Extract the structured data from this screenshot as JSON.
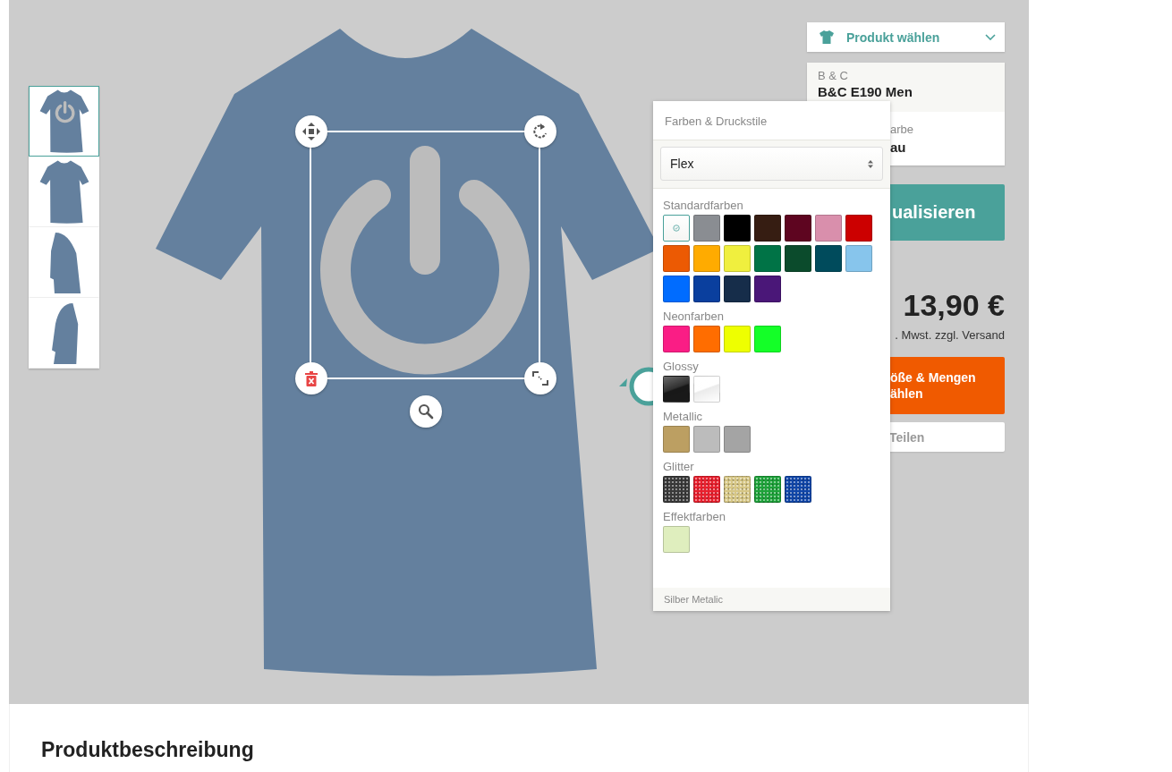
{
  "thumbnails": [
    {
      "kind": "front-design",
      "selected": true
    },
    {
      "kind": "back",
      "selected": false
    },
    {
      "kind": "sleeve-left",
      "selected": false
    },
    {
      "kind": "sleeve-right",
      "selected": false
    }
  ],
  "product_selector": {
    "label": "Produkt wählen"
  },
  "product_info": {
    "brand": "B & C",
    "name": "B&C E190 Men",
    "color_label": "arbe",
    "color_value": "au"
  },
  "update_button": "ualisieren",
  "price": "13,90 €",
  "price_note": ". Mwst. zzgl. Versand",
  "order_button": [
    "öße & Mengen",
    "ählen"
  ],
  "share_button": "Teilen",
  "color_panel": {
    "title": "Farben & Druckstile",
    "print_style": "Flex",
    "groups": [
      {
        "name": "Standardfarben",
        "swatches": [
          {
            "kind": "solid",
            "color": "#ffffff",
            "selected": true
          },
          {
            "kind": "solid",
            "color": "#8a8d92",
            "selected": false
          },
          {
            "kind": "solid",
            "color": "#000000",
            "selected": false
          },
          {
            "kind": "solid",
            "color": "#361d12",
            "selected": false
          },
          {
            "kind": "solid",
            "color": "#5e0520",
            "selected": false
          },
          {
            "kind": "solid",
            "color": "#d98fac",
            "selected": false
          },
          {
            "kind": "solid",
            "color": "#cc0000",
            "selected": false
          },
          {
            "kind": "solid",
            "color": "#ec5a03",
            "selected": false
          },
          {
            "kind": "solid",
            "color": "#ffab00",
            "selected": false
          },
          {
            "kind": "solid",
            "color": "#f0ef3e",
            "selected": false
          },
          {
            "kind": "solid",
            "color": "#007346",
            "selected": false
          },
          {
            "kind": "solid",
            "color": "#0b4b2c",
            "selected": false
          },
          {
            "kind": "solid",
            "color": "#004b5c",
            "selected": false
          },
          {
            "kind": "solid",
            "color": "#87c5ec",
            "selected": false
          },
          {
            "kind": "solid",
            "color": "#006cff",
            "selected": false
          },
          {
            "kind": "solid",
            "color": "#0a3f9e",
            "selected": false
          },
          {
            "kind": "solid",
            "color": "#162d4a",
            "selected": false
          },
          {
            "kind": "solid",
            "color": "#4a1778",
            "selected": false
          }
        ]
      },
      {
        "name": "Neonfarben",
        "swatches": [
          {
            "kind": "solid",
            "color": "#fa1d85",
            "selected": false
          },
          {
            "kind": "solid",
            "color": "#ff6d00",
            "selected": false
          },
          {
            "kind": "solid",
            "color": "#eeff00",
            "selected": false
          },
          {
            "kind": "solid",
            "color": "#14ff28",
            "selected": false
          }
        ]
      },
      {
        "name": "Glossy",
        "swatches": [
          {
            "kind": "glossy",
            "color": "#1a1a1a",
            "selected": false
          },
          {
            "kind": "glossy",
            "color": "#ffffff",
            "selected": false
          }
        ]
      },
      {
        "name": "Metallic",
        "swatches": [
          {
            "kind": "solid",
            "color": "#bc9f62",
            "selected": false
          },
          {
            "kind": "solid",
            "color": "#bcbcbc",
            "selected": false
          },
          {
            "kind": "solid",
            "color": "#a4a4a4",
            "selected": false
          }
        ]
      },
      {
        "name": "Glitter",
        "swatches": [
          {
            "kind": "glitter",
            "color": "#3a3a3a",
            "selected": false
          },
          {
            "kind": "glitter",
            "color": "#e8202e",
            "selected": false
          },
          {
            "kind": "glitter",
            "color": "#d6c685",
            "selected": false
          },
          {
            "kind": "glitter",
            "color": "#1ea23a",
            "selected": false
          },
          {
            "kind": "glitter",
            "color": "#1046a8",
            "selected": false
          }
        ]
      },
      {
        "name": "Effektfarben",
        "swatches": [
          {
            "kind": "solid",
            "color": "#dfeebe",
            "selected": false
          }
        ]
      }
    ],
    "hovered_color_name": "Silber Metalic"
  },
  "description_heading": "Produktbeschreibung"
}
